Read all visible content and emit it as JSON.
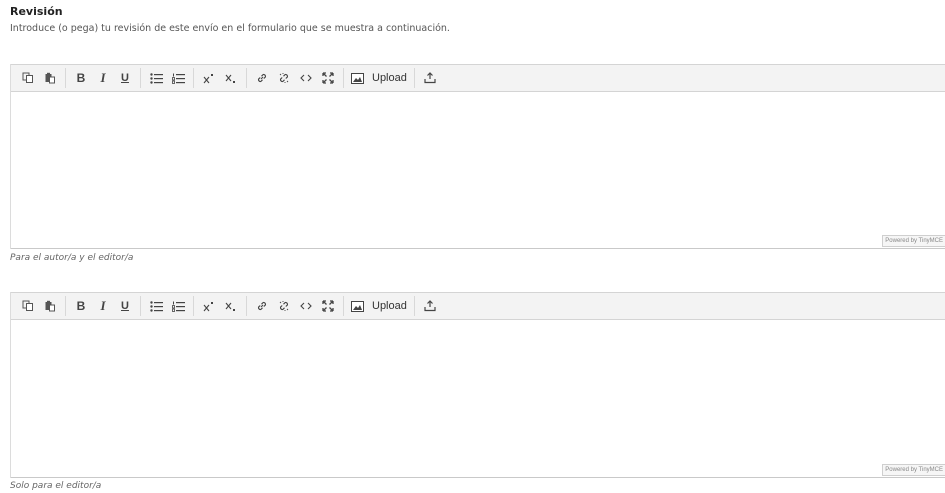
{
  "section": {
    "title": "Revisión",
    "description": "Introduce (o pega) tu revisión de este envío en el formulario que se muestra a continuación."
  },
  "toolbar": {
    "bold_label": "B",
    "italic_label": "I",
    "underline_label": "U",
    "upload_label": "Upload",
    "icons": [
      "copy-icon",
      "paste-icon",
      "bold-icon",
      "italic-icon",
      "underline-icon",
      "bullet-list-icon",
      "numbered-list-icon",
      "superscript-icon",
      "subscript-icon",
      "link-icon",
      "unlink-icon",
      "code-icon",
      "fullscreen-icon",
      "image-upload-icon",
      "download-icon"
    ]
  },
  "editors": [
    {
      "powered_by": "Powered by TinyMCE",
      "note": "Para el autor/a y el editor/a"
    },
    {
      "powered_by": "Powered by TinyMCE",
      "note": "Solo para el editor/a"
    }
  ]
}
